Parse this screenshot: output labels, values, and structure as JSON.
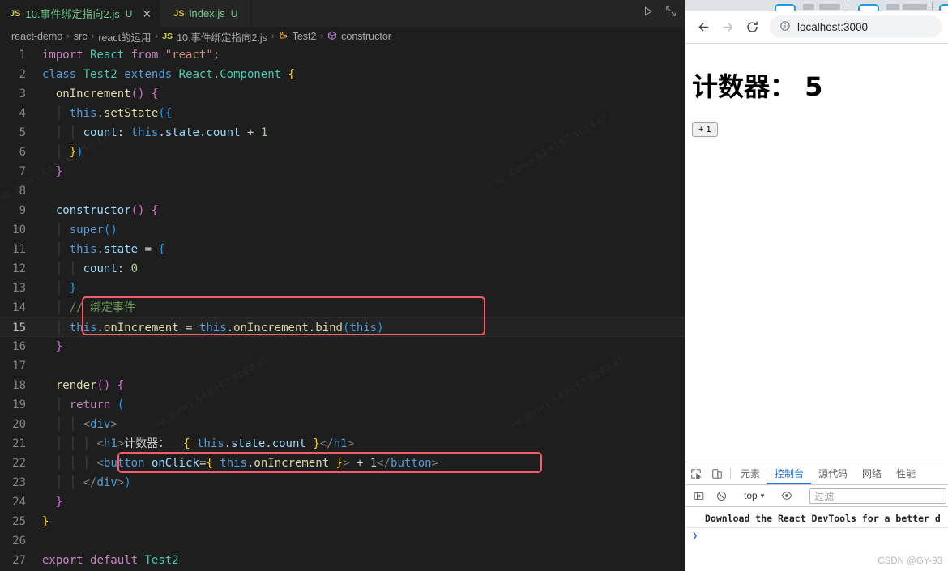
{
  "editor": {
    "tabs": [
      {
        "icon": "js-file-icon",
        "label": "10.事件绑定指向2.js",
        "git": "U",
        "close": "✕",
        "active": true
      },
      {
        "icon": "js-file-icon",
        "label": "index.js",
        "git": "U",
        "close": "",
        "active": false
      }
    ],
    "actions": [
      {
        "name": "run-code-button",
        "glyph": "▷"
      },
      {
        "name": "split-editor-button",
        "glyph": "⤡"
      }
    ],
    "breadcrumbs": [
      {
        "label": "react-demo",
        "icon": ""
      },
      {
        "label": "src",
        "icon": ""
      },
      {
        "label": "react的运用",
        "icon": ""
      },
      {
        "label": "10.事件绑定指向2.js",
        "icon": "js-file-icon"
      },
      {
        "label": "Test2",
        "icon": "class-symbol-icon"
      },
      {
        "label": "constructor",
        "icon": "method-symbol-icon"
      }
    ],
    "breadcrumb_separator": "›",
    "line_count": 27,
    "highlighted_line": 15,
    "annotations": [
      {
        "name": "bind-event-annotation",
        "lines": "14-15",
        "color": "#fa5c6a"
      },
      {
        "name": "onclick-button-annotation",
        "lines": "22",
        "color": "#fa5c6a"
      }
    ],
    "code_lines": [
      "import React from \"react\";",
      "class Test2 extends React.Component {",
      "  onIncrement() {",
      "    this.setState({",
      "      count: this.state.count + 1",
      "    })",
      "  }",
      "",
      "  constructor() {",
      "    super()",
      "    this.state = {",
      "      count: 0",
      "    }",
      "    // 绑定事件",
      "    this.onIncrement = this.onIncrement.bind(this)",
      "  }",
      "",
      "  render() {",
      "    return (",
      "      <div>",
      "        <h1>计数器：  { this.state.count }</h1>",
      "        <button onClick={ this.onIncrement }> + 1</button>",
      "      </div>)",
      "  }",
      "}",
      "",
      "export default Test2"
    ],
    "watermarks": [
      "up_guowy A4:83:E7:91:E4:67",
      "up_guowy A4:83:E7:91:E4:67",
      "up_guowy A4:83:E7:91:E4:67",
      "up_guowy A4:83:E7:91:E4:67"
    ]
  },
  "browser": {
    "nav": {
      "back": "←",
      "forward": "→",
      "reload": "↻",
      "url": "localhost:3000",
      "security_icon": "info-circle-icon"
    },
    "page": {
      "heading": "计数器：  5",
      "button_label": "+ 1"
    },
    "devtools": {
      "tabs": [
        {
          "label": "元素",
          "active": false
        },
        {
          "label": "控制台",
          "active": true
        },
        {
          "label": "源代码",
          "active": false
        },
        {
          "label": "网络",
          "active": false
        },
        {
          "label": "性能",
          "active": false
        }
      ],
      "left_icons": [
        {
          "name": "inspect-element-icon",
          "glyph": "inspect"
        },
        {
          "name": "device-toolbar-icon",
          "glyph": "device"
        }
      ],
      "filter_row": {
        "sidebar_toggle": "sidebar-toggle-icon",
        "clear_console": "clear-console-icon",
        "context": "top",
        "context_caret": "▾",
        "eye_icon": "live-expression-icon",
        "filter_placeholder": "过滤"
      },
      "console_message": "Download the React DevTools for a better d",
      "prompt": "❯",
      "watermark": "CSDN @GY-93"
    }
  },
  "colors": {
    "editor_bg": "#1e1e1e",
    "tab_bg": "#252526",
    "annotation": "#fa5c6a",
    "devtools_accent": "#1a73e8",
    "chrome_tab_accent": "#1e9ae0"
  }
}
